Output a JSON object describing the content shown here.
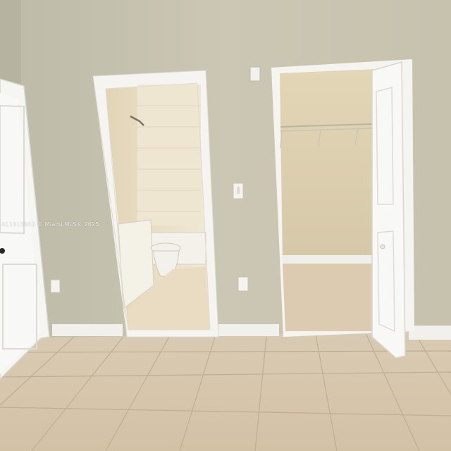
{
  "photo": {
    "watermark": "A11815863 © Miami MLS® 2025",
    "colors": {
      "wall": "#c9c5b2",
      "floor_tile": "#d8c7ad",
      "trim": "#f4f3ef",
      "closet_interior": "#dccfb0",
      "bathroom_tile": "#ece3cf"
    }
  }
}
